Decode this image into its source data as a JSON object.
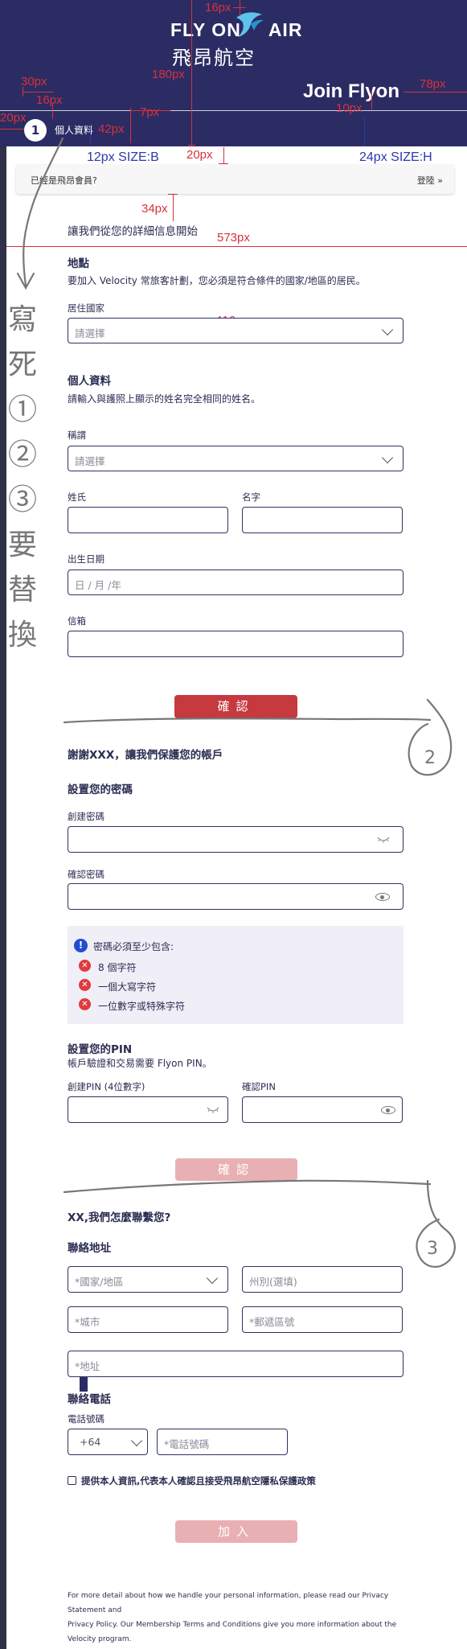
{
  "header": {
    "logo_en_left": "FLY ON",
    "logo_en_right": "AIR",
    "logo_zh": "飛昂航空",
    "join_title": "Join Flyon",
    "step_number": "1",
    "step_label": "個人資料",
    "bg_color": "#2b2c63"
  },
  "annotations": {
    "a16": "16px",
    "a180": "180px",
    "a30": "30px",
    "a16b": "16px",
    "a20": "20px",
    "a42": "42px",
    "a7": "7px",
    "a20b": "20px",
    "a10": "10px",
    "a78": "78px",
    "b_size": "12px SIZE:B",
    "h_size": "24px SIZE:H",
    "a34": "34px",
    "a573": "573px",
    "a416": "416px"
  },
  "member": {
    "question": "已經是飛昂會員?",
    "login": "登陸 »"
  },
  "intro": "讓我們從您的詳細信息開始",
  "location": {
    "title": "地點",
    "desc": "要加入 Velocity 常旅客計劃，您必須是符合條件的國家/地區的居民。",
    "country_label": "居住國家",
    "country_placeholder": "請選擇"
  },
  "personal": {
    "title": "個人資料",
    "desc": "請輸入與護照上顯示的姓名完全相同的姓名。",
    "salutation_label": "稱謂",
    "salutation_placeholder": "請選擇",
    "last_name_label": "姓氏",
    "first_name_label": "名字",
    "dob_label": "出生日期",
    "dob_placeholder": "日 / 月 /年",
    "email_label": "信箱",
    "confirm_label": "確認"
  },
  "handwriting": {
    "left_note": "寫死 ① ② ③ 要替換",
    "circle2": "2",
    "circle3": "3"
  },
  "account": {
    "thanks": "謝謝XXX，讓我們保護您的帳戶",
    "password_title": "設置您的密碼",
    "create_password_label": "創建密碼",
    "confirm_password_label": "確認密碼",
    "rules_title": "密碼必須至少包含:",
    "rules": [
      "8 個字符",
      "一個大寫字符",
      "一位數字或特殊字符"
    ],
    "pin_title": "設置您的PIN",
    "pin_desc": "帳戶驗證和交易需要 Flyon PIN。",
    "create_pin_label": "創建PIN (4位數字)",
    "confirm_pin_label": "確認PIN",
    "confirm_label": "確認"
  },
  "contact": {
    "title": "XX,我們怎麼聯繫您?",
    "address_title": "聯絡地址",
    "country_placeholder": "*國家/地區",
    "state_placeholder": "州別(選填)",
    "city_placeholder": "*城市",
    "postcode_placeholder": "*郵遞區號",
    "address_placeholder": "*地址",
    "phone_title": "聯絡電話",
    "phone_label": "電話號碼",
    "country_code": "+64",
    "phone_placeholder": "*電話號碼",
    "consent": "提供本人資訊,代表本人確認且接受飛昂航空隱私保護政策",
    "join_label": "加入"
  },
  "footer": {
    "line1": "For more detail about how we handle your personal information, please read our Privacy Statement and",
    "line2": "Privacy Policy. Our Membership Terms and Conditions give you more information about the Velocity program."
  }
}
